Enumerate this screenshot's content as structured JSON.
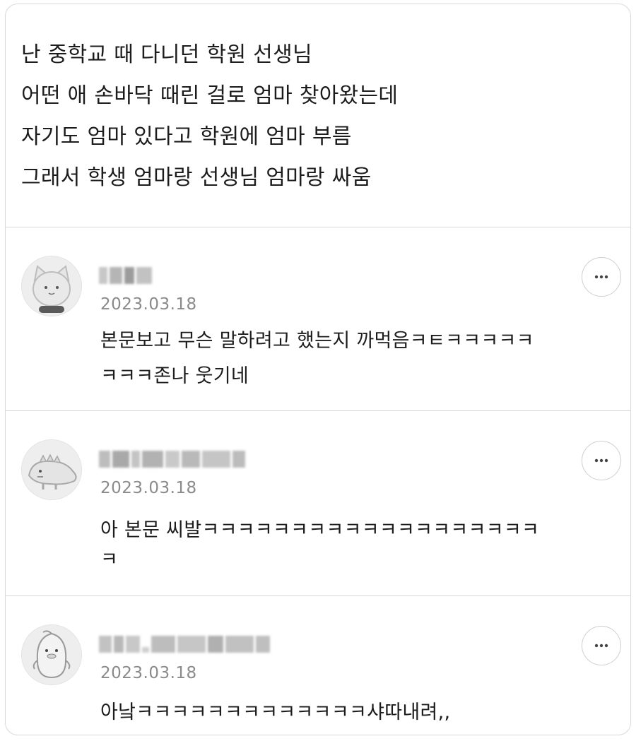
{
  "post": {
    "lines": [
      "난 중학교 때 다니던 학원 선생님",
      "어떤 애 손바닥 때린 걸로 엄마 찾아왔는데",
      "자기도 엄마 있다고 학원에 엄마 부름",
      "그래서 학생 엄마랑 선생님 엄마랑 싸움"
    ]
  },
  "comments": [
    {
      "avatar_icon": "cat-avatar-icon",
      "date": "2023.03.18",
      "lines": [
        "본문보고 무슨 말하려고 했는지 까먹음ㅋㅌㅋㅋㅋㅋㅋ",
        "ㅋㅋㅋ존나 웃기네"
      ]
    },
    {
      "avatar_icon": "dinosaur-avatar-icon",
      "date": "2023.03.18",
      "lines": [
        "아 본문 씨발ㅋㅋㅋㅋㅋㅋㅋㅋㅋㅋㅋㅋㅋㅋㅋㅋㅋㅋㅋ",
        "ㅋ"
      ]
    },
    {
      "avatar_icon": "penguin-avatar-icon",
      "date": "2023.03.18",
      "lines": [
        "아낰ㅋㅋㅋㅋㅋㅋㅋㅋㅋㅋㅋㅋㅋ샤따내려,,"
      ]
    }
  ],
  "colors": {
    "text": "#1c1c1c",
    "date": "#8a8a8a",
    "divider": "#d6d6d6",
    "border": "#d9d9d9"
  }
}
